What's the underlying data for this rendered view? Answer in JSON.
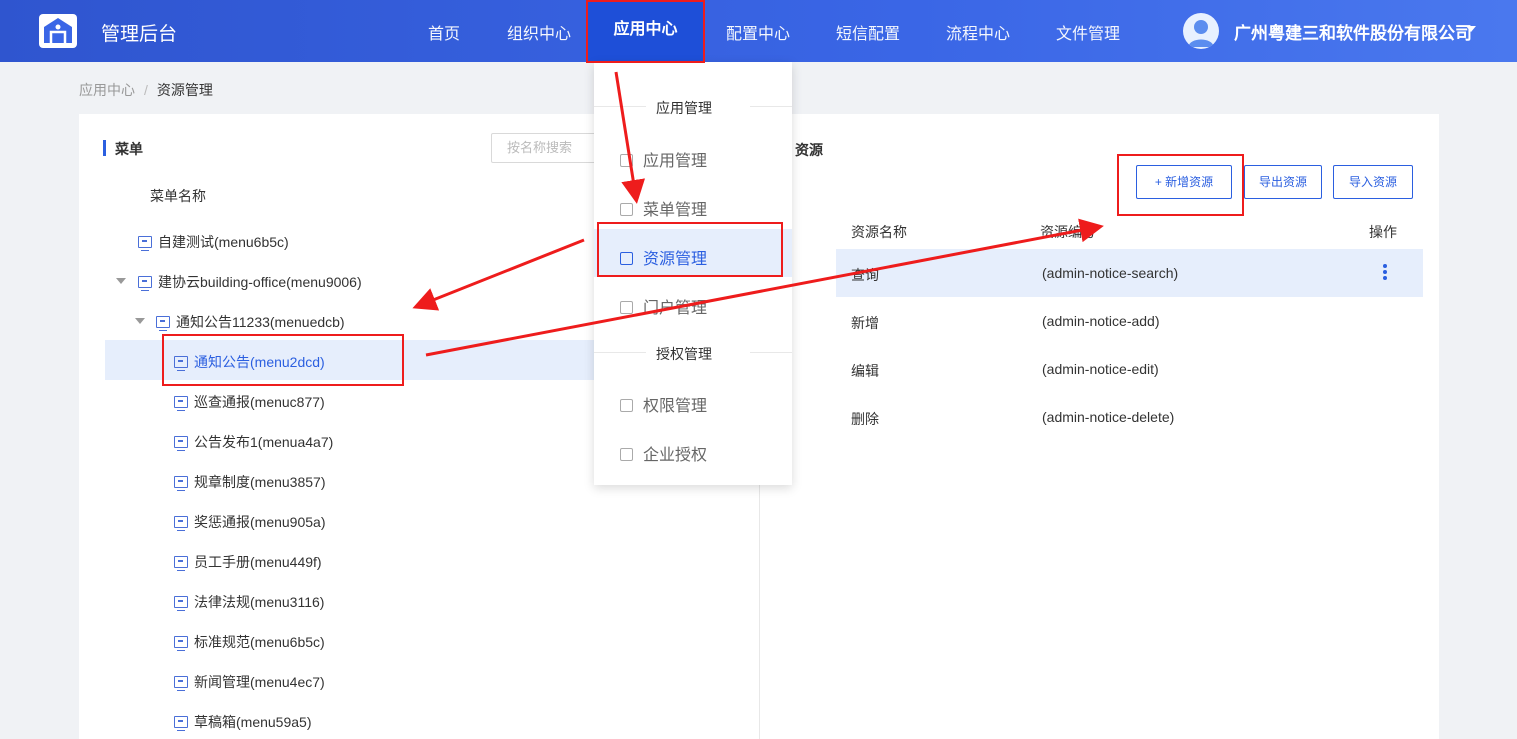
{
  "header": {
    "app_title": "管理后台",
    "nav": [
      "首页",
      "组织中心",
      "应用中心",
      "配置中心",
      "短信配置",
      "流程中心",
      "文件管理"
    ],
    "active_nav": "应用中心",
    "company": "广州粤建三和软件股份有限公司"
  },
  "breadcrumb": {
    "parent": "应用中心",
    "sep": "/",
    "current": "资源管理"
  },
  "menu_panel": {
    "title": "菜单",
    "search_placeholder": "按名称搜索",
    "column_title": "菜单名称",
    "tree": [
      "自建测试(menu6b5c)",
      "建协云building-office(menu9006)",
      "通知公告11233(menuedcb)",
      "通知公告(menu2dcd)",
      "巡查通报(menuc877)",
      "公告发布1(menua4a7)",
      "规章制度(menu3857)",
      "奖惩通报(menu905a)",
      "员工手册(menu449f)",
      "法律法规(menu3116)",
      "标准规范(menu6b5c)",
      "新闻管理(menu4ec7)",
      "草稿箱(menu59a5)"
    ]
  },
  "resource_panel": {
    "title": "资源",
    "buttons": {
      "add": "+ 新增资源",
      "export": "导出资源",
      "import": "导入资源"
    },
    "columns": {
      "name": "资源名称",
      "code": "资源编号",
      "action": "操作"
    },
    "rows": [
      {
        "name": "查询",
        "code": "(admin-notice-search)"
      },
      {
        "name": "新增",
        "code": "(admin-notice-add)"
      },
      {
        "name": "编辑",
        "code": "(admin-notice-edit)"
      },
      {
        "name": "删除",
        "code": "(admin-notice-delete)"
      }
    ]
  },
  "dropdown": {
    "group1": "应用管理",
    "group2": "授权管理",
    "items": [
      "应用管理",
      "菜单管理",
      "资源管理",
      "门户管理",
      "权限管理",
      "企业授权"
    ],
    "active_item": "资源管理"
  },
  "colors": {
    "primary": "#2b5fe0",
    "header": "#3a66e6",
    "annotation": "#ee1c1c"
  }
}
